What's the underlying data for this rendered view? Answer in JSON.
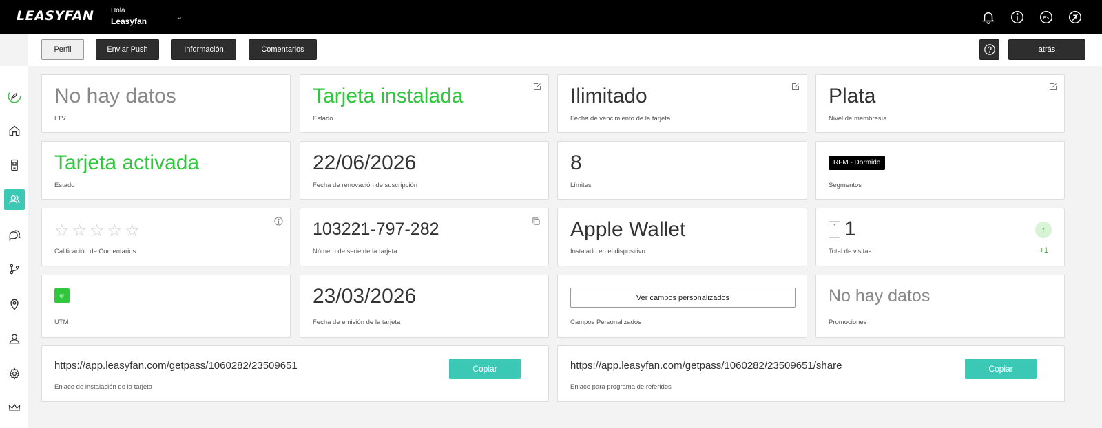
{
  "app": {
    "logo": "LEASYFAN",
    "greeting": "Hola",
    "user_name": "Leasyfan",
    "language": "Es"
  },
  "toolbar": {
    "perfil": "Perfil",
    "push": "Enviar Push",
    "info": "Información",
    "comments": "Comentarios",
    "back": "atrás"
  },
  "sidebar": {
    "items": [
      "rocket-icon",
      "home-icon",
      "phone-card-icon",
      "users-icon",
      "chat-icon",
      "flow-icon",
      "location-icon",
      "user-icon",
      "gear-icon",
      "crown-icon"
    ],
    "active_index": 3
  },
  "cards": {
    "ltv": {
      "value": "No hay datos",
      "label": "LTV"
    },
    "estado1": {
      "value": "Tarjeta instalada",
      "label": "Estado"
    },
    "vencimiento": {
      "value": "Ilimitado",
      "label": "Fecha de vencimiento de la tarjeta"
    },
    "nivel": {
      "value": "Plata",
      "label": "Nivel de membresía"
    },
    "estado2": {
      "value": "Tarjeta activada",
      "label": "Estado"
    },
    "renovacion": {
      "value": "22/06/2026",
      "label": "Fecha de renovación de suscripción"
    },
    "limites": {
      "value": "8",
      "label": "Límites"
    },
    "segmentos": {
      "badge": "RFM - Dormido",
      "label": "Segmentos"
    },
    "calificacion": {
      "stars": 0,
      "max_stars": 5,
      "label": "Calificación de Comentarios"
    },
    "serie": {
      "value": "103221-797-282",
      "label": "Número de serie de la tarjeta"
    },
    "dispositivo": {
      "value": "Apple Wallet",
      "label": "Instalado en el dispositivo"
    },
    "visitas": {
      "value": "1",
      "delta": "+1",
      "label": "Total de visitas",
      "stepper_plus": "+",
      "stepper_minus": "-"
    },
    "utm": {
      "tag": "qr",
      "label": "UTM"
    },
    "emision": {
      "value": "23/03/2026",
      "label": "Fecha de emisión de la tarjeta"
    },
    "campos": {
      "button": "Ver campos personalizados",
      "label": "Campos Personalizados"
    },
    "promociones": {
      "value": "No hay datos",
      "label": "Promociones"
    },
    "install_link": {
      "url": "https://app.leasyfan.com/getpass/1060282/23509651",
      "label": "Enlace de instalación de la tarjeta",
      "button": "Copiar"
    },
    "referral_link": {
      "url": "https://app.leasyfan.com/getpass/1060282/23509651/share",
      "label": "Enlace para programa de referidos",
      "button": "Copiar"
    }
  },
  "colors": {
    "accent": "#3bc8b5",
    "green": "#2fc73c",
    "dark": "#000000"
  }
}
